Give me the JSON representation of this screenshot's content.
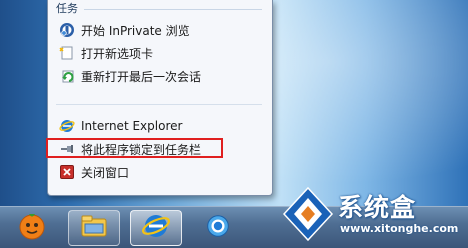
{
  "jumplist": {
    "section_header": "任务",
    "tasks": [
      {
        "label": "开始 InPrivate 浏览",
        "icon": "inprivate-icon"
      },
      {
        "label": "打开新选项卡",
        "icon": "new-tab-icon"
      },
      {
        "label": "重新打开最后一次会话",
        "icon": "reopen-session-icon"
      }
    ],
    "app_label": "Internet Explorer",
    "pin_label": "将此程序锁定到任务栏",
    "close_label": "关闭窗口"
  },
  "taskbar": {
    "items": [
      {
        "name": "start-orb-icon"
      },
      {
        "name": "file-explorer-icon"
      },
      {
        "name": "internet-explorer-icon",
        "state": "active"
      },
      {
        "name": "internet-explorer-icon-2"
      }
    ]
  },
  "watermark": {
    "title": "系统盒",
    "url": "www.xitonghe.com"
  },
  "colors": {
    "highlight": "#e01f1f",
    "ie_blue": "#1f7bd6",
    "ie_ring": "#f3c316",
    "close_red": "#c8302b"
  }
}
